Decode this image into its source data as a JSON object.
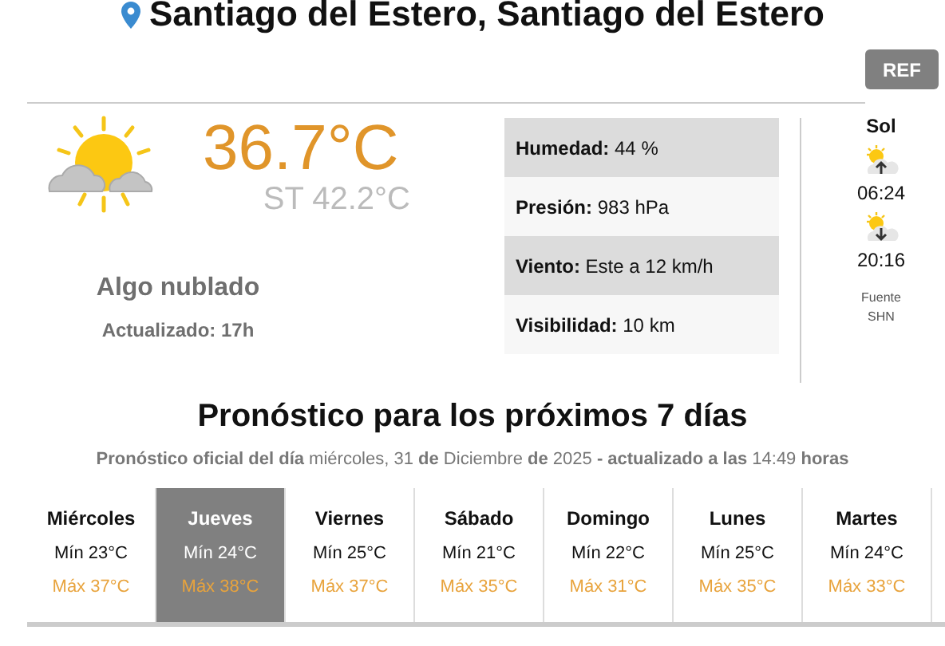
{
  "location": {
    "title": "Santiago del Estero, Santiago del Estero"
  },
  "refresh_button": "REF",
  "current": {
    "temperature": "36.7°C",
    "feels_like": "ST 42.2°C",
    "condition": "Algo nublado",
    "updated": "Actualizado: 17h"
  },
  "details": [
    {
      "label": "Humedad:",
      "value": "44 %"
    },
    {
      "label": "Presión:",
      "value": "983 hPa"
    },
    {
      "label": "Viento:",
      "value": "Este a 12 km/h"
    },
    {
      "label": "Visibilidad:",
      "value": "10 km"
    }
  ],
  "sun": {
    "title": "Sol",
    "events": [
      {
        "kind": "sunrise",
        "time": "06:24"
      },
      {
        "kind": "sunset",
        "time": "20:16"
      }
    ],
    "source": [
      "Fuente",
      "SHN"
    ]
  },
  "forecast": {
    "title": "Pronóstico para los próximos 7 días",
    "subtitle": "**Pronóstico oficial del día** miércoles, 31 **de** Diciembre **de** 2025 **- actualizado a las** 14:49 **horas**",
    "days": [
      {
        "day": "Miércoles",
        "min": "Mín 23°C",
        "max": "Máx 37°C",
        "selected": false
      },
      {
        "day": "Jueves",
        "min": "Mín 24°C",
        "max": "Máx 38°C",
        "selected": true
      },
      {
        "day": "Viernes",
        "min": "Mín 25°C",
        "max": "Máx 37°C",
        "selected": false
      },
      {
        "day": "Sábado",
        "min": "Mín 21°C",
        "max": "Máx 35°C",
        "selected": false
      },
      {
        "day": "Domingo",
        "min": "Mín 22°C",
        "max": "Máx 31°C",
        "selected": false
      },
      {
        "day": "Lunes",
        "min": "Mín 25°C",
        "max": "Máx 35°C",
        "selected": false
      },
      {
        "day": "Martes",
        "min": "Mín 24°C",
        "max": "Máx 33°C",
        "selected": false
      }
    ]
  }
}
